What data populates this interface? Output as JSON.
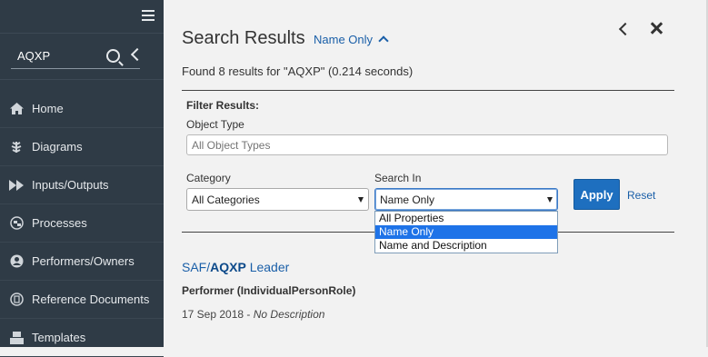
{
  "sidebar": {
    "search_value": "AQXP",
    "items": [
      {
        "label": "Home",
        "icon": "home-icon"
      },
      {
        "label": "Diagrams",
        "icon": "diagram-icon"
      },
      {
        "label": "Inputs/Outputs",
        "icon": "fast-forward-icon"
      },
      {
        "label": "Processes",
        "icon": "process-icon"
      },
      {
        "label": "Performers/Owners",
        "icon": "user-circle-icon"
      },
      {
        "label": "Reference Documents",
        "icon": "document-icon"
      },
      {
        "label": "Templates",
        "icon": "template-icon"
      }
    ]
  },
  "main": {
    "title": "Search Results",
    "mode_toggle": "Name Only",
    "found_text": "Found 8 results for \"AQXP\" (0.214 seconds)",
    "filter": {
      "heading": "Filter Results:",
      "object_type_label": "Object Type",
      "object_type_placeholder": "All Object Types",
      "category_label": "Category",
      "category_value": "All Categories",
      "search_in_label": "Search In",
      "search_in_value": "Name Only",
      "search_in_options": [
        "All Properties",
        "Name Only",
        "Name and Description"
      ],
      "apply_label": "Apply",
      "reset_label": "Reset"
    },
    "result": {
      "prefix": "SAF/",
      "highlight": "AQXP",
      "suffix": " Leader",
      "type": "Performer (IndividualPersonRole)",
      "date": "17 Sep 2018",
      "sep": " - ",
      "description": "No Description"
    }
  }
}
